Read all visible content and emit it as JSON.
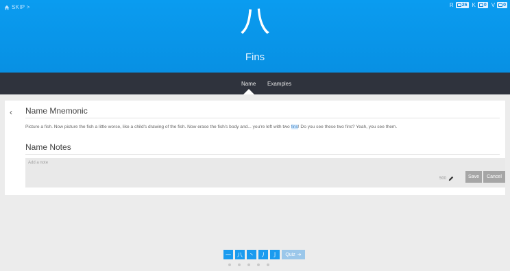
{
  "header": {
    "skip_label": "SKIP >",
    "kanji": "八",
    "meaning": "Fins",
    "counters": [
      {
        "letter": "R",
        "value": "26"
      },
      {
        "letter": "K",
        "value": "0"
      },
      {
        "letter": "V",
        "value": "0"
      }
    ]
  },
  "tabs": {
    "name": "Name",
    "examples": "Examples"
  },
  "mnemonic": {
    "title": "Name Mnemonic",
    "text_before": "Picture a fish. Now picture the fish a little worse, like a child's drawing of the fish. Now erase the fish's body and... you're left with two ",
    "highlight": "fins",
    "text_after": "! Do you see these two fins? Yeah, you see them."
  },
  "notes": {
    "title": "Name Notes",
    "placeholder": "Add a note",
    "char_count": "500",
    "save_label": "Save",
    "cancel_label": "Cancel"
  },
  "pager": {
    "items": [
      "一",
      "八",
      "丶",
      "丿",
      "亅"
    ],
    "quiz_label": "Quiz"
  },
  "colors": {
    "header_blue": "#0a9cf0",
    "tabbar": "#2f333d",
    "pager_blue": "#1a9bef"
  }
}
